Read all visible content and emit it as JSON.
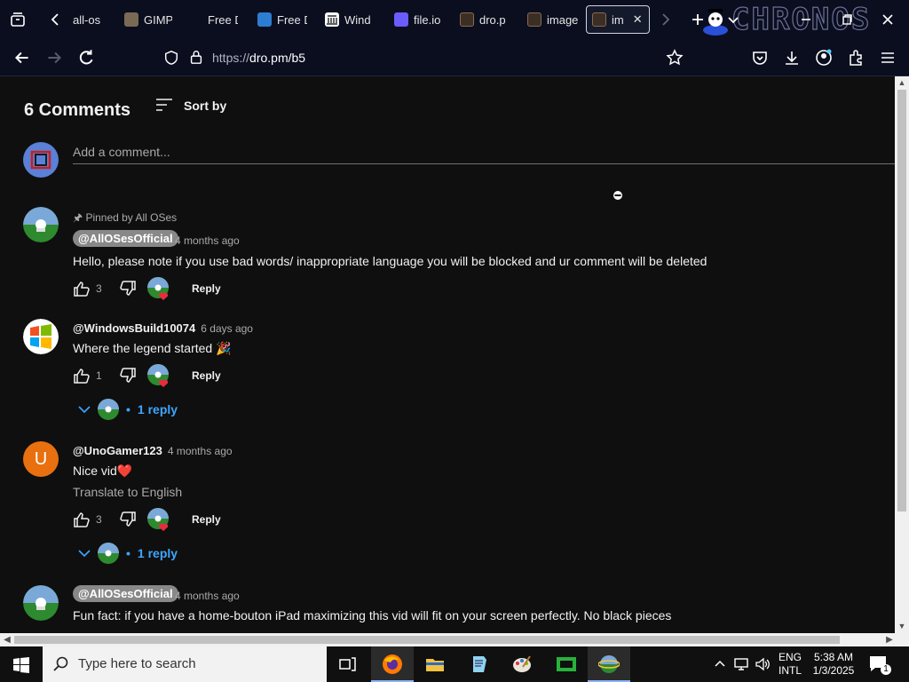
{
  "browser": {
    "tabs": [
      {
        "label": "all-os",
        "fav_color": "#1e1e1e"
      },
      {
        "label": "GIMP",
        "fav_color": "#7a6a55"
      },
      {
        "label": "Free D",
        "fav_color": "#0a0e1f"
      },
      {
        "label": "Free D",
        "fav_color": "#2d7dd2"
      },
      {
        "label": "Wind",
        "fav_color": "#ffffff"
      },
      {
        "label": "file.io",
        "fav_color": "#6b5cff"
      },
      {
        "label": "dro.p",
        "fav_color": "#3b2f25"
      },
      {
        "label": "image",
        "fav_color": "#3b2f25"
      },
      {
        "label": "im",
        "fav_color": "#3b2f25"
      }
    ],
    "url_dim": "https://",
    "url_main": "dro.pm/b5",
    "brand_watermark": "CHRONOS"
  },
  "comments_header": {
    "count_label": "6 Comments",
    "sort_label": "Sort by",
    "add_placeholder": "Add a comment..."
  },
  "comments": [
    {
      "pinned": "Pinned by All OSes",
      "author": "@AllOSesOfficial",
      "time": "4 months ago",
      "text": "Hello, please note if you use bad words/ inappropriate language you will be blocked and ur comment will be deleted",
      "likes": "3",
      "reply_label": "Reply"
    },
    {
      "author": "@WindowsBuild10074",
      "time": "6 days ago",
      "text": "Where the legend started 🎉",
      "likes": "1",
      "reply_label": "Reply",
      "replies_label": "1 reply"
    },
    {
      "author": "@UnoGamer123",
      "time": "4 months ago",
      "text": "Nice vid❤️",
      "translate": "Translate to English",
      "likes": "3",
      "reply_label": "Reply",
      "replies_label": "1 reply",
      "avatar_letter": "U"
    },
    {
      "author": "@AllOSesOfficial",
      "time": "4 months ago",
      "text": "Fun fact: if you have a home-bouton iPad maximizing this vid will fit on your screen perfectly. No black pieces"
    }
  ],
  "taskbar": {
    "search_placeholder": "Type here to search",
    "lang_top": "ENG",
    "lang_bottom": "INTL",
    "time": "5:38 AM",
    "date": "1/3/2025",
    "notif_count": "1"
  },
  "colors": {
    "accent_link": "#3ea6ff",
    "avatar_orange": "#e8700f",
    "heart": "#e52d3c"
  }
}
